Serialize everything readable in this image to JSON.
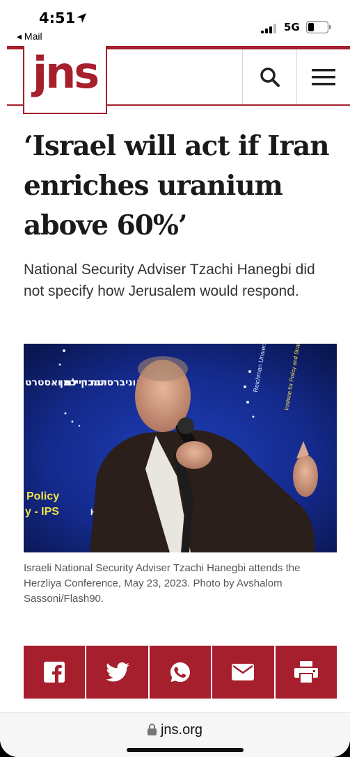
{
  "status_bar": {
    "time": "4:51",
    "back_app": "◂ Mail",
    "network": "5G"
  },
  "header": {
    "logo": "jns",
    "icons": [
      "search-icon",
      "menu-icon"
    ],
    "brand_color": "#a51f2d"
  },
  "article": {
    "headline": "‘Israel will act if Iran enriches uranium above 60%’",
    "subhead": "National Security Adviser Tzachi Hanegbi did not specify how Jerusalem would respond.",
    "photo": {
      "sign_hebrew_1": "אוניברסיטת רייכמן",
      "sign_hebrew_2": "המכון למ ואסטרט",
      "sign_policy": "Policy",
      "sign_ips": "y - IPS",
      "sign_he": "HE",
      "sign_reichman": "Reichman University",
      "sign_institute": "Institute for Policy and Strategy - IPS"
    },
    "caption": "Israeli National Security Adviser Tzachi Hanegbi attends the Herzliya Conference, May 23, 2023. Photo by Avshalom Sassoni/Flash90."
  },
  "share": {
    "buttons": [
      "facebook-icon",
      "twitter-icon",
      "whatsapp-icon",
      "email-icon",
      "print-icon"
    ]
  },
  "url_bar": {
    "url": "jns.org"
  }
}
